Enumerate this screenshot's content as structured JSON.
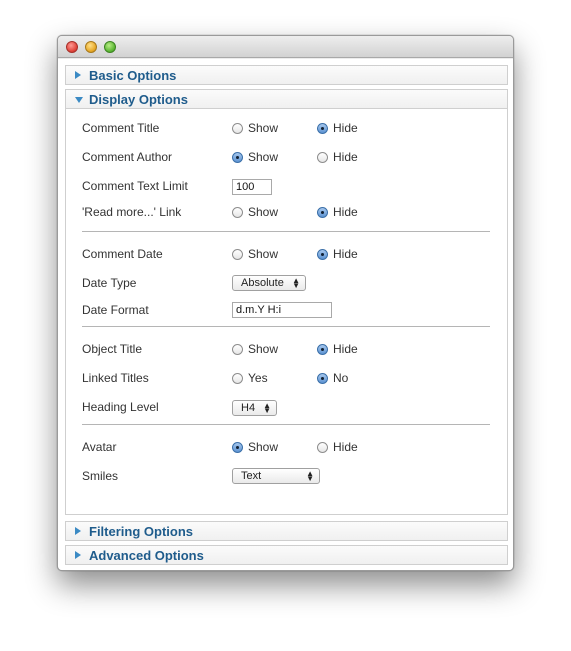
{
  "panels": {
    "basic": {
      "label": "Basic Options"
    },
    "display": {
      "label": "Display Options"
    },
    "filtering": {
      "label": "Filtering Options"
    },
    "advanced": {
      "label": "Advanced Options"
    }
  },
  "options": {
    "comment_title": {
      "label": "Comment Title",
      "opt1": "Show",
      "opt2": "Hide",
      "selected": "Hide"
    },
    "comment_author": {
      "label": "Comment Author",
      "opt1": "Show",
      "opt2": "Hide",
      "selected": "Show"
    },
    "comment_text_limit": {
      "label": "Comment Text Limit",
      "value": "100"
    },
    "read_more_link": {
      "label": "'Read more...' Link",
      "opt1": "Show",
      "opt2": "Hide",
      "selected": "Hide"
    },
    "comment_date": {
      "label": "Comment Date",
      "opt1": "Show",
      "opt2": "Hide",
      "selected": "Hide"
    },
    "date_type": {
      "label": "Date Type",
      "value": "Absolute"
    },
    "date_format": {
      "label": "Date Format",
      "value": "d.m.Y H:i"
    },
    "object_title": {
      "label": "Object Title",
      "opt1": "Show",
      "opt2": "Hide",
      "selected": "Hide"
    },
    "linked_titles": {
      "label": "Linked Titles",
      "opt1": "Yes",
      "opt2": "No",
      "selected": "No"
    },
    "heading_level": {
      "label": "Heading Level",
      "value": "H4"
    },
    "avatar": {
      "label": "Avatar",
      "opt1": "Show",
      "opt2": "Hide",
      "selected": "Show"
    },
    "smiles": {
      "label": "Smiles",
      "value": "Text"
    }
  },
  "colors": {
    "accent": "#1f5c8c",
    "arrow": "#3b8ac4"
  }
}
